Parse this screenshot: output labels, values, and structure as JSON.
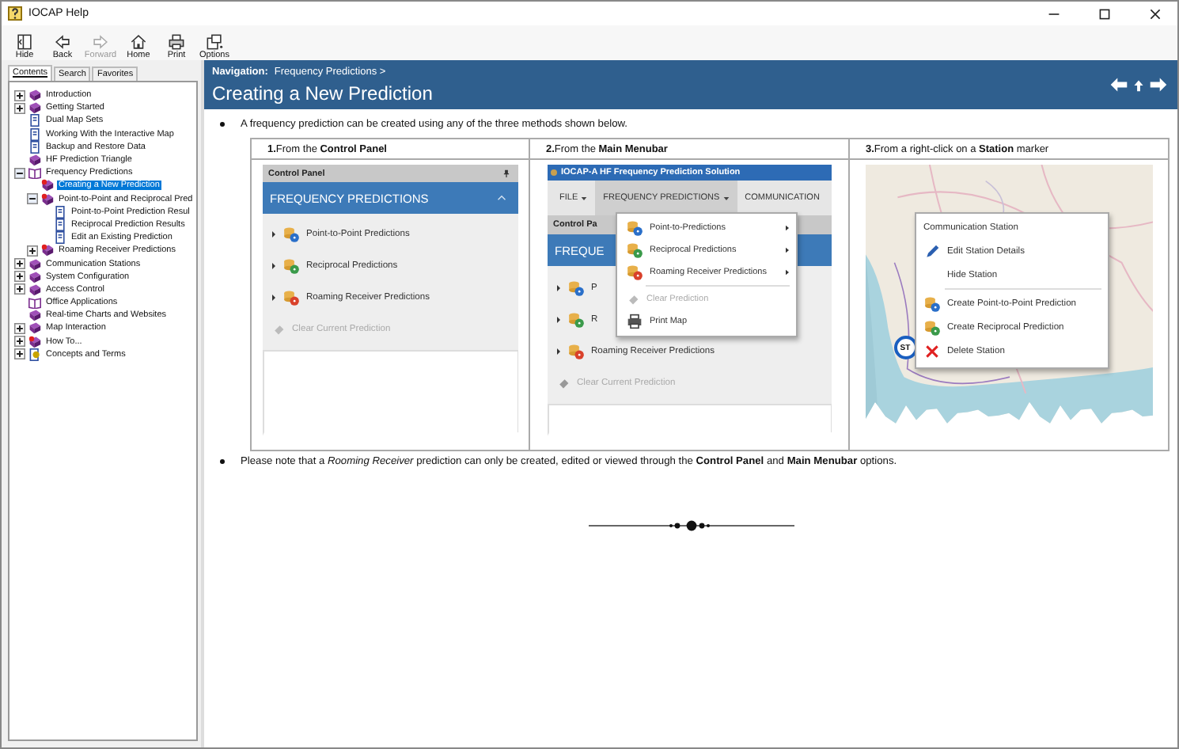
{
  "window": {
    "title": "IOCAP Help"
  },
  "toolbar": [
    {
      "label": "Hide",
      "kind": "hide",
      "disabled": false
    },
    {
      "label": "Back",
      "kind": "back",
      "disabled": false
    },
    {
      "label": "Forward",
      "kind": "forward",
      "disabled": true
    },
    {
      "label": "Home",
      "kind": "home",
      "disabled": false
    },
    {
      "label": "Print",
      "kind": "print",
      "disabled": false
    },
    {
      "label": "Options",
      "kind": "options",
      "disabled": false
    }
  ],
  "nav_tabs": [
    {
      "label": "Contents",
      "selected": true
    },
    {
      "label": "Search",
      "selected": false
    },
    {
      "label": "Favorites",
      "selected": false
    }
  ],
  "tree": [
    {
      "label": "Introduction",
      "kind": "book",
      "expanded": false,
      "selected": false
    },
    {
      "label": "Getting Started",
      "kind": "book",
      "expanded": false,
      "selected": false
    },
    {
      "label": "Dual Map Sets",
      "kind": "page",
      "selected": false
    },
    {
      "label": "Working With the Interactive Map",
      "kind": "page",
      "selected": false
    },
    {
      "label": "Backup and Restore Data",
      "kind": "page",
      "selected": false
    },
    {
      "label": "HF Prediction Triangle",
      "kind": "book",
      "selected": false
    },
    {
      "label": "Frequency Predictions",
      "kind": "open-book",
      "expanded": true,
      "selected": false,
      "children": [
        {
          "label": "Creating a New Prediction",
          "kind": "marked-book",
          "selected": true
        },
        {
          "label": "Point-to-Point and Reciprocal Pred",
          "kind": "marked-book",
          "expanded": true,
          "selected": false,
          "children": [
            {
              "label": "Point-to-Point Prediction Resul",
              "kind": "page",
              "selected": false
            },
            {
              "label": "Reciprocal Prediction Results",
              "kind": "page",
              "selected": false
            },
            {
              "label": "Edit an Existing Prediction",
              "kind": "page",
              "selected": false
            }
          ]
        },
        {
          "label": "Roaming Receiver Predictions",
          "kind": "marked-book",
          "expanded": false,
          "selected": false
        }
      ]
    },
    {
      "label": "Communication Stations",
      "kind": "book",
      "expanded": false,
      "selected": false
    },
    {
      "label": "System Configuration",
      "kind": "book",
      "expanded": false,
      "selected": false
    },
    {
      "label": "Access Control",
      "kind": "book",
      "expanded": false,
      "selected": false
    },
    {
      "label": "Office Applications",
      "kind": "open-book",
      "selected": false
    },
    {
      "label": "Real-time Charts and Websites",
      "kind": "book",
      "selected": false
    },
    {
      "label": "Map Interaction",
      "kind": "book",
      "expanded": false,
      "selected": false
    },
    {
      "label": "How To...",
      "kind": "marked-book",
      "expanded": false,
      "selected": false
    },
    {
      "label": "Concepts and Terms",
      "kind": "concept",
      "expanded": false,
      "selected": false
    }
  ],
  "header": {
    "navigation_label": "Navigation:",
    "breadcrumb": "Frequency Predictions >",
    "title": "Creating a New Prediction"
  },
  "intro": "A frequency prediction can be created using any of the three methods shown below.",
  "methods": [
    {
      "number": "1.",
      "text": "From the **Control Panel**"
    },
    {
      "number": "2.",
      "text": "From the **Main Menubar**"
    },
    {
      "number": "3.",
      "text": "From a right-click on a **Station** marker"
    }
  ],
  "control_panel_shot": {
    "panel_title": "Control Panel",
    "section": "FREQUENCY PREDICTIONS",
    "items": [
      {
        "label": "Point-to-Point Predictions",
        "color": "#2a6fc9",
        "disabled": false
      },
      {
        "label": "Reciprocal Predictions",
        "color": "#3a9a4a",
        "disabled": false
      },
      {
        "label": "Roaming Receiver Predictions",
        "color": "#d9412b",
        "disabled": false
      }
    ],
    "clear": {
      "label": "Clear Current Prediction",
      "disabled": true
    }
  },
  "menubar_shot": {
    "app_title": "IOCAP-A HF Frequency Prediction Solution",
    "menus": [
      {
        "label": "FILE",
        "selected": false,
        "caret": true
      },
      {
        "label": "FREQUENCY PREDICTIONS",
        "selected": true,
        "caret": true
      },
      {
        "label": "COMMUNICATION",
        "selected": false,
        "caret": false
      }
    ],
    "panel_title": "Control Pa",
    "section": "FREQUE",
    "rows": [
      {
        "label": "P",
        "color": "#2a6fc9",
        "disabled": false
      },
      {
        "label": "R",
        "color": "#3a9a4a",
        "disabled": false
      },
      {
        "label": "Roaming Receiver Predictions",
        "color": "#d9412b",
        "disabled": false
      },
      {
        "label": "Clear Current Prediction",
        "color": "#999999",
        "disabled": true
      }
    ],
    "dropdown": [
      {
        "label": "Point-to-Predictions",
        "kind": "prediction",
        "color": "#2a6fc9",
        "submenu": true,
        "disabled": false
      },
      {
        "label": "Reciprocal Predictions",
        "kind": "prediction",
        "color": "#3a9a4a",
        "submenu": true,
        "disabled": false
      },
      {
        "label": "Roaming Receiver Predictions",
        "kind": "prediction",
        "color": "#d9412b",
        "submenu": true,
        "disabled": false
      },
      {
        "kind": "separator"
      },
      {
        "label": "Clear Prediction",
        "kind": "clear",
        "submenu": false,
        "disabled": true
      },
      {
        "label": "Print Map",
        "kind": "print",
        "submenu": false,
        "disabled": false
      }
    ]
  },
  "map_shot": {
    "marker": "ST",
    "menu_title": "Communication Station",
    "menu": [
      {
        "label": "Edit Station Details",
        "kind": "edit"
      },
      {
        "label": "Hide Station",
        "kind": "plain"
      },
      {
        "kind": "separator"
      },
      {
        "label": "Create Point-to-Point Prediction",
        "kind": "prediction",
        "color": "#2a6fc9"
      },
      {
        "label": "Create Reciprocal Prediction",
        "kind": "prediction",
        "color": "#3a9a4a"
      },
      {
        "label": "Delete Station",
        "kind": "delete"
      }
    ]
  },
  "note": "Please note that a *Rooming Receiver* prediction can only be created, edited or viewed through the **Control Panel** and **Main Menubar** options."
}
